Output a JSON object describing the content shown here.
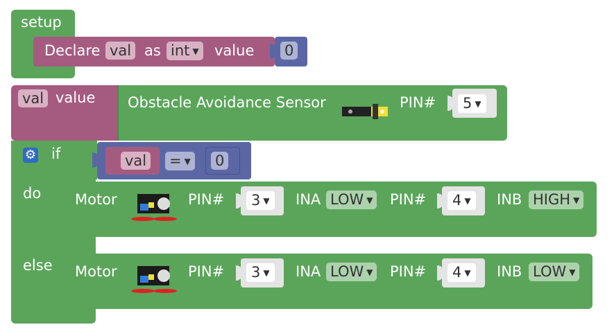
{
  "setup_block": {
    "label": "setup",
    "declare": {
      "prefix": "Declare",
      "var_name": "val",
      "as_label": "as",
      "type_value": "int",
      "value_label": "value",
      "number": "0"
    }
  },
  "assign_block": {
    "var_name": "val",
    "value_label": "value",
    "sensor_label": "Obstacle Avoidance Sensor",
    "pin_label": "PIN#",
    "pin_value": "5"
  },
  "if_block": {
    "gear_icon": "gear-icon",
    "if_label": "if",
    "do_label": "do",
    "else_label": "else",
    "condition": {
      "left": "val",
      "operator": "=",
      "right": "0"
    }
  },
  "motor_do": {
    "label": "Motor",
    "pin1_label": "PIN#",
    "pin1_value": "3",
    "ina_label": "INA",
    "ina_value": "LOW",
    "pin2_label": "PIN#",
    "pin2_value": "4",
    "inb_label": "INB",
    "inb_value": "HIGH"
  },
  "motor_else": {
    "label": "Motor",
    "pin1_label": "PIN#",
    "pin1_value": "3",
    "ina_label": "INA",
    "ina_value": "LOW",
    "pin2_label": "PIN#",
    "pin2_value": "4",
    "inb_label": "INB",
    "inb_value": "LOW"
  },
  "colors": {
    "green_block": "#5ba55b",
    "maroon_block": "#a55b80",
    "blue_block": "#5b67a5"
  }
}
